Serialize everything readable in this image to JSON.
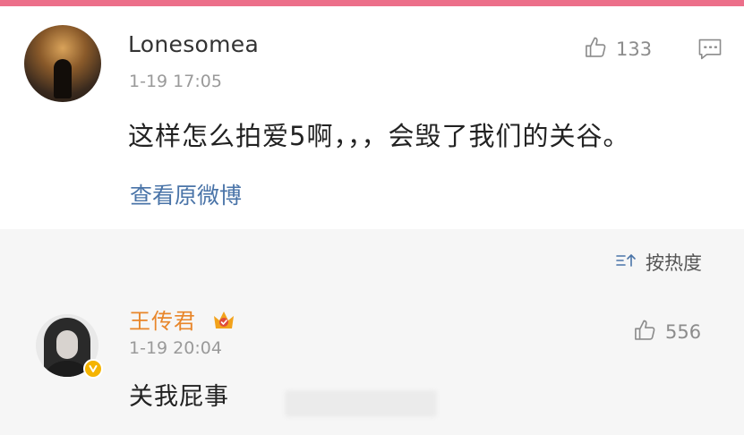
{
  "post": {
    "username": "Lonesomea",
    "time": "1-19 17:05",
    "likes": "133",
    "content": "这样怎么拍爱5啊，，，会毁了我们的关谷。",
    "view_original": "查看原微博"
  },
  "sort": {
    "label": "按热度"
  },
  "reply": {
    "username": "王传君",
    "time": "1-19 20:04",
    "likes": "556",
    "content": "关我屁事"
  },
  "colors": {
    "top_bar": "#ec6f8a",
    "link": "#4a74a8",
    "vip_username": "#e8862a",
    "verified_badge": "#f5b400"
  },
  "icons": {
    "like": "thumbs-up-outline-icon",
    "comment": "comment-bubble-icon",
    "sort": "sort-lines-icon",
    "vip": "vip-crown-badge-icon",
    "verified": "verified-v-icon"
  }
}
